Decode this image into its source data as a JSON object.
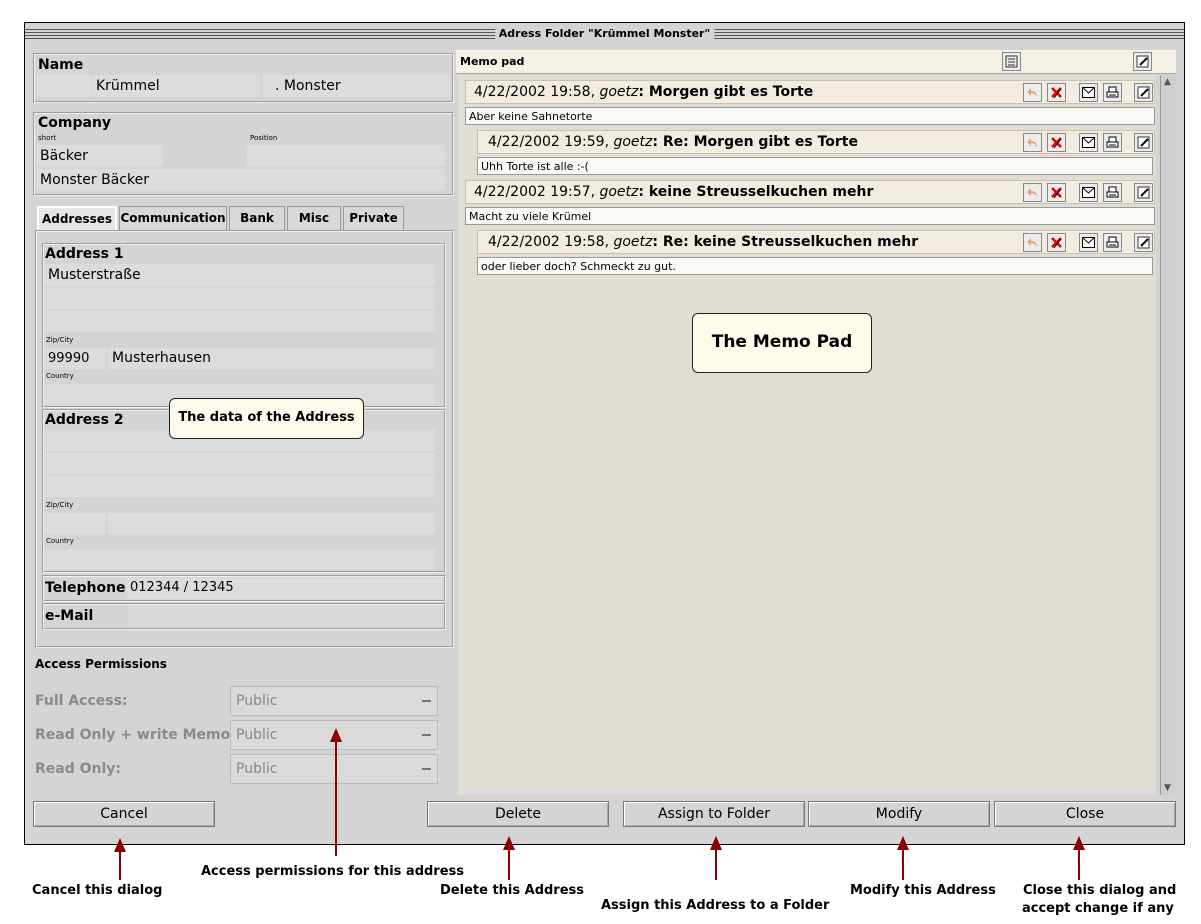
{
  "window": {
    "title": "Adress Folder \"Krümmel Monster\""
  },
  "name_section": {
    "label": "Name",
    "first": "Krümmel",
    "last": ". Monster"
  },
  "company_section": {
    "label": "Company",
    "short_label": "short",
    "position_label": "Position",
    "short_value": "Bäcker",
    "full_name": "Monster Bäcker"
  },
  "tabs": [
    {
      "label": "Addresses"
    },
    {
      "label": "Communication"
    },
    {
      "label": "Bank"
    },
    {
      "label": "Misc"
    },
    {
      "label": "Private"
    }
  ],
  "address1": {
    "label": "Address 1",
    "street": "Musterstraße",
    "zip_city_label": "Zip/City",
    "zip": "99990",
    "city": "Musterhausen",
    "country_label": "Country"
  },
  "address2": {
    "label": "Address 2",
    "zip_city_label": "Zip/City",
    "country_label": "Country"
  },
  "telephone": {
    "label": "Telephone",
    "value": "012344 / 12345"
  },
  "email": {
    "label": "e-Mail"
  },
  "access": {
    "title": "Access Permissions",
    "full_label": "Full Access:",
    "full_value": "Public",
    "memo_label": "Read Only + write Memo :",
    "memo_value": "Public",
    "read_label": "Read Only:",
    "read_value": "Public"
  },
  "memo": {
    "title": "Memo pad",
    "entries": [
      {
        "meta": "4/22/2002 19:58,",
        "author": "goetz",
        "subject": ": Morgen gibt es Torte",
        "body": "Aber keine Sahnetorte"
      },
      {
        "meta": "4/22/2002 19:59,",
        "author": "goetz",
        "subject": ": Re:  Morgen gibt es Torte",
        "body": "Uhh Torte ist alle :-("
      },
      {
        "meta": "4/22/2002 19:57,",
        "author": "goetz",
        "subject": ": keine Streusselkuchen mehr",
        "body": "Macht zu viele Krümel"
      },
      {
        "meta": "4/22/2002 19:58,",
        "author": "goetz",
        "subject": ": Re:  keine Streusselkuchen mehr",
        "body": "oder lieber doch? Schmeckt zu gut."
      }
    ]
  },
  "buttons": {
    "cancel": "Cancel",
    "delete": "Delete",
    "assign": "Assign to Folder",
    "modify": "Modify",
    "close": "Close"
  },
  "callouts": {
    "address": "The data of the Address",
    "memo": "The Memo Pad"
  },
  "annotations": {
    "cancel": "Cancel this dialog",
    "access": "Access permissions for this address",
    "delete": "Delete this Address",
    "assign": "Assign this Address to a Folder",
    "modify": "Modify this Address",
    "close_1": "Close this dialog and",
    "close_2": "accept change  if any"
  },
  "colors": {
    "arrow": "#8b0000",
    "memo_header": "#f2ebe0",
    "callout": "#fffbeb"
  }
}
